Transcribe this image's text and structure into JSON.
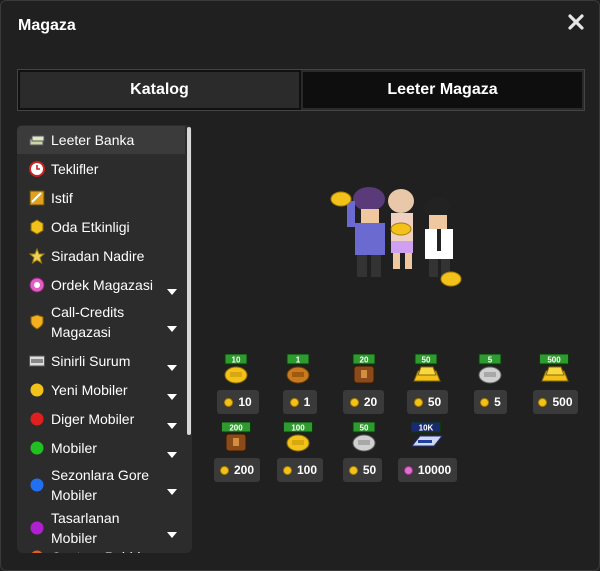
{
  "window": {
    "title": "Magaza"
  },
  "tabs": [
    {
      "label": "Katalog",
      "active": false
    },
    {
      "label": "Leeter Magaza",
      "active": true
    }
  ],
  "sidebar": {
    "items": [
      {
        "label": "Leeter Banka",
        "icon": "money-stack-icon",
        "selected": true,
        "expandable": false
      },
      {
        "label": "Teklifler",
        "icon": "clock-icon",
        "selected": false,
        "expandable": false
      },
      {
        "label": "Istif",
        "icon": "stack-box-icon",
        "selected": false,
        "expandable": false
      },
      {
        "label": "Oda Etkinligi",
        "icon": "hexagon-icon",
        "selected": false,
        "expandable": false
      },
      {
        "label": "Siradan Nadire",
        "icon": "star-icon",
        "selected": false,
        "expandable": false
      },
      {
        "label": "Ordek Magazasi",
        "icon": "duck-icon",
        "selected": false,
        "expandable": true
      },
      {
        "label": "Call-Credits Magazasi",
        "icon": "shield-icon",
        "selected": false,
        "expandable": true
      },
      {
        "label": "Sinirli Surum",
        "icon": "ltd-icon",
        "selected": false,
        "expandable": true
      },
      {
        "label": "Yeni Mobiler",
        "icon": "yellow-dot-icon",
        "selected": false,
        "expandable": true
      },
      {
        "label": "Diger Mobiler",
        "icon": "red-dot-icon",
        "selected": false,
        "expandable": true
      },
      {
        "label": "Mobiler",
        "icon": "green-dot-icon",
        "selected": false,
        "expandable": true
      },
      {
        "label": "Sezonlara Gore Mobiler",
        "icon": "blue-dot-icon",
        "selected": false,
        "expandable": true
      },
      {
        "label": "Tasarlanan Mobiler",
        "icon": "purple-dot-icon",
        "selected": false,
        "expandable": true
      },
      {
        "label": "Centaur Pubhi",
        "icon": "orange-dot-icon",
        "selected": false,
        "expandable": true
      }
    ]
  },
  "products": [
    {
      "tag": "10",
      "kind": "gold-bag",
      "price": "10",
      "currency": "coin"
    },
    {
      "tag": "1",
      "kind": "bronze-bag",
      "price": "1",
      "currency": "coin"
    },
    {
      "tag": "20",
      "kind": "bronze-chest",
      "price": "20",
      "currency": "coin"
    },
    {
      "tag": "50",
      "kind": "gold-bar",
      "price": "50",
      "currency": "coin"
    },
    {
      "tag": "5",
      "kind": "silver-bag",
      "price": "5",
      "currency": "coin"
    },
    {
      "tag": "500",
      "kind": "gold-bar",
      "price": "500",
      "currency": "coin"
    },
    {
      "tag": "200",
      "kind": "bronze-chest",
      "price": "200",
      "currency": "coin"
    },
    {
      "tag": "100",
      "kind": "gold-bag",
      "price": "100",
      "currency": "coin"
    },
    {
      "tag": "50",
      "kind": "silver-bag",
      "price": "50",
      "currency": "coin"
    },
    {
      "tag": "10K",
      "kind": "card",
      "price": "10000",
      "currency": "diamond"
    }
  ],
  "colors": {
    "background": "#202020",
    "panel": "#2c2c2c",
    "price_bg": "#3a3a3a",
    "tag_green": "#2f9a2f",
    "coin": "#f2c21a"
  }
}
